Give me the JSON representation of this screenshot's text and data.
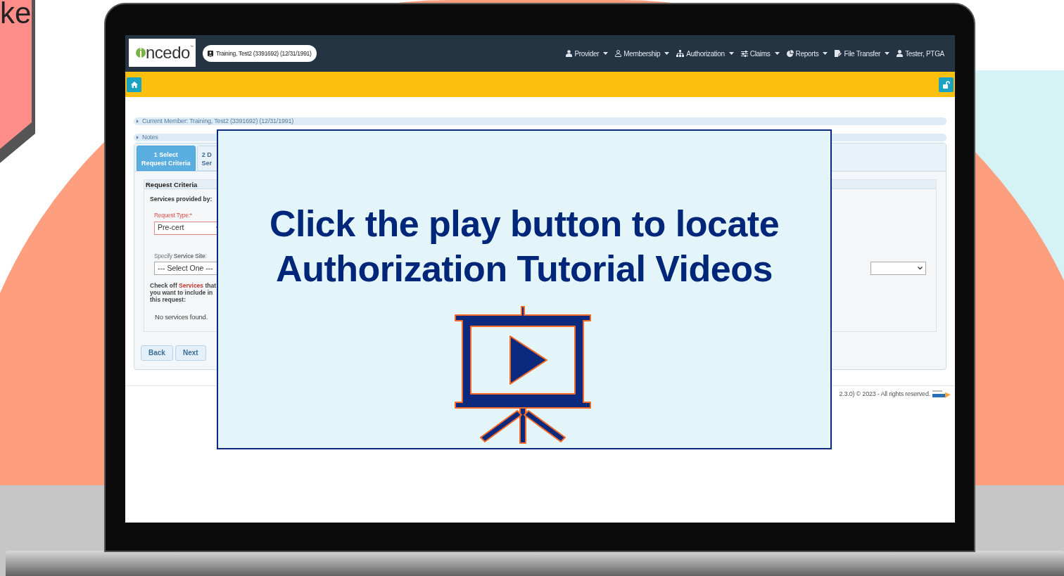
{
  "slide_fragment": {
    "text": "ke"
  },
  "app": {
    "logo": {
      "text": "ncedo",
      "mark": "™"
    },
    "member_pill": "Training, Test2 (3391692) (12/31/1991)",
    "nav": [
      {
        "label": "Provider",
        "dropdown": true
      },
      {
        "label": "Membership",
        "dropdown": true
      },
      {
        "label": "Authorization",
        "dropdown": true
      },
      {
        "label": "Claims",
        "dropdown": true
      },
      {
        "label": "Reports",
        "dropdown": true
      },
      {
        "label": "File Transfer",
        "dropdown": true
      },
      {
        "label": "Tester, PTGA",
        "dropdown": false
      }
    ],
    "panels": [
      {
        "label": "Current Member: Training, Test2 (3391692) (12/31/1991)"
      },
      {
        "label": "Notes"
      }
    ],
    "steps": [
      {
        "lines": [
          "1 Select",
          "Request Criteria"
        ],
        "selected": true
      },
      {
        "lines": [
          "2 D",
          "Ser"
        ],
        "selected": false
      }
    ],
    "section_title": "Request Criteria",
    "services_heading": "Services provided by:",
    "request_type": {
      "label": "Request Type:*",
      "value": "Pre-cert",
      "required": true
    },
    "service_site": {
      "label": "Specify **Service Site**:",
      "value": "--- Select One ---"
    },
    "check_note": {
      "before": "Check off ",
      "highlight": "Services",
      "after": " that you want to include in this request:"
    },
    "no_services": "No services found.",
    "buttons": [
      "Back",
      "Next"
    ],
    "footer": "2.3.0) © 2023 - All rights reserved."
  },
  "overlay": {
    "title_lines": [
      "Click the play button to locate",
      "Authorization Tutorial Videos"
    ]
  }
}
